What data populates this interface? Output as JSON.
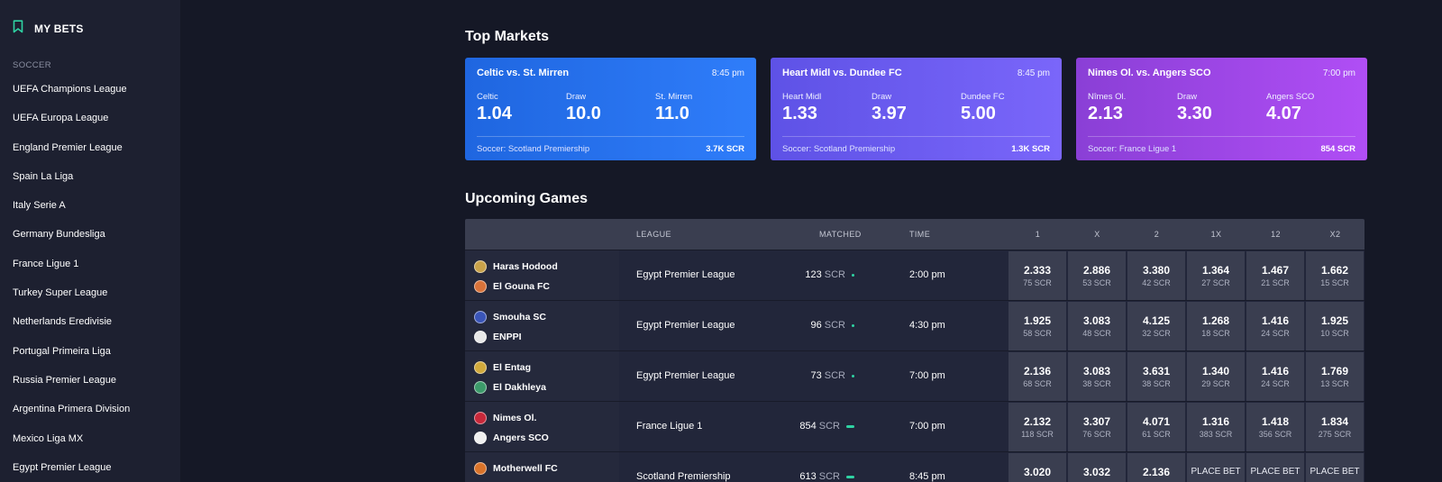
{
  "sidebar": {
    "my_bets_label": "MY BETS",
    "section_label": "SOCCER",
    "leagues": [
      "UEFA Champions League",
      "UEFA Europa League",
      "England Premier League",
      "Spain La Liga",
      "Italy Serie A",
      "Germany Bundesliga",
      "France Ligue 1",
      "Turkey Super League",
      "Netherlands Eredivisie",
      "Portugal Primeira Liga",
      "Russia Premier League",
      "Argentina Primera Division",
      "Mexico Liga MX",
      "Egypt Premier League"
    ]
  },
  "top_markets": {
    "heading": "Top Markets",
    "cards": [
      {
        "title": "Celtic vs. St. Mirren",
        "time": "8:45 pm",
        "odds": [
          {
            "label": "Celtic",
            "value": "1.04"
          },
          {
            "label": "Draw",
            "value": "10.0"
          },
          {
            "label": "St. Mirren",
            "value": "11.0"
          }
        ],
        "league": "Soccer: Scotland Premiership",
        "volume": "3.7K SCR",
        "gradient": [
          "#1f66e0",
          "#2f7dfa"
        ]
      },
      {
        "title": "Heart Midl vs. Dundee FC",
        "time": "8:45 pm",
        "odds": [
          {
            "label": "Heart Midl",
            "value": "1.33"
          },
          {
            "label": "Draw",
            "value": "3.97"
          },
          {
            "label": "Dundee FC",
            "value": "5.00"
          }
        ],
        "league": "Soccer: Scotland Premiership",
        "volume": "1.3K SCR",
        "gradient": [
          "#5e52e6",
          "#7a66fa"
        ]
      },
      {
        "title": "Nimes Ol. vs. Angers SCO",
        "time": "7:00 pm",
        "odds": [
          {
            "label": "Nîmes Ol.",
            "value": "2.13"
          },
          {
            "label": "Draw",
            "value": "3.30"
          },
          {
            "label": "Angers SCO",
            "value": "4.07"
          }
        ],
        "league": "Soccer: France Ligue 1",
        "volume": "854 SCR",
        "gradient": [
          "#8a3fd6",
          "#b04ef5"
        ]
      }
    ]
  },
  "upcoming": {
    "heading": "Upcoming Games",
    "columns": {
      "league": "LEAGUE",
      "matched": "MATCHED",
      "time": "TIME",
      "markets": [
        "1",
        "X",
        "2",
        "1X",
        "12",
        "X2"
      ]
    },
    "scr_unit": "SCR",
    "place_bet_label": "PLACE BET",
    "rows": [
      {
        "home": "Haras Hodood",
        "away": "El Gouna FC",
        "home_logo_color": "#c9a24a",
        "away_logo_color": "#d9733a",
        "league": "Egypt Premier League",
        "matched": "123",
        "indicator": "dot",
        "time": "2:00 pm",
        "odds": [
          {
            "v": "2.333",
            "s": "75 SCR"
          },
          {
            "v": "2.886",
            "s": "53 SCR"
          },
          {
            "v": "3.380",
            "s": "42 SCR"
          },
          {
            "v": "1.364",
            "s": "27 SCR"
          },
          {
            "v": "1.467",
            "s": "21 SCR"
          },
          {
            "v": "1.662",
            "s": "15 SCR"
          }
        ]
      },
      {
        "home": "Smouha SC",
        "away": "ENPPI",
        "home_logo_color": "#3a55b8",
        "away_logo_color": "#e8e8e8",
        "league": "Egypt Premier League",
        "matched": "96",
        "indicator": "dot",
        "time": "4:30 pm",
        "odds": [
          {
            "v": "1.925",
            "s": "58 SCR"
          },
          {
            "v": "3.083",
            "s": "48 SCR"
          },
          {
            "v": "4.125",
            "s": "32 SCR"
          },
          {
            "v": "1.268",
            "s": "18 SCR"
          },
          {
            "v": "1.416",
            "s": "24 SCR"
          },
          {
            "v": "1.925",
            "s": "10 SCR"
          }
        ]
      },
      {
        "home": "El Entag",
        "away": "El Dakhleya",
        "home_logo_color": "#d1a93c",
        "away_logo_color": "#3c9a6a",
        "league": "Egypt Premier League",
        "matched": "73",
        "indicator": "dot",
        "time": "7:00 pm",
        "odds": [
          {
            "v": "2.136",
            "s": "68 SCR"
          },
          {
            "v": "3.083",
            "s": "38 SCR"
          },
          {
            "v": "3.631",
            "s": "38 SCR"
          },
          {
            "v": "1.340",
            "s": "29 SCR"
          },
          {
            "v": "1.416",
            "s": "24 SCR"
          },
          {
            "v": "1.769",
            "s": "13 SCR"
          }
        ]
      },
      {
        "home": "Nimes Ol.",
        "away": "Angers SCO",
        "home_logo_color": "#c8283a",
        "away_logo_color": "#f0f0f0",
        "league": "France Ligue 1",
        "matched": "854",
        "indicator": "bar",
        "time": "7:00 pm",
        "odds": [
          {
            "v": "2.132",
            "s": "118 SCR"
          },
          {
            "v": "3.307",
            "s": "76 SCR"
          },
          {
            "v": "4.071",
            "s": "61 SCR"
          },
          {
            "v": "1.316",
            "s": "383 SCR"
          },
          {
            "v": "1.418",
            "s": "356 SCR"
          },
          {
            "v": "1.834",
            "s": "275 SCR"
          }
        ]
      },
      {
        "home": "Motherwell FC",
        "away": "",
        "home_logo_color": "#d9732a",
        "away_logo_color": "#2a9a5a",
        "league": "Scotland Premiership",
        "matched": "613",
        "indicator": "bar",
        "time": "8:45 pm",
        "odds": [
          {
            "v": "3.020",
            "s": ""
          },
          {
            "v": "3.032",
            "s": ""
          },
          {
            "v": "2.136",
            "s": ""
          },
          {
            "place": true
          },
          {
            "place": true
          },
          {
            "place": true
          }
        ]
      }
    ]
  },
  "colors": {
    "background": "#151826",
    "sidebar": "#1d2030",
    "accent": "#2fd3a3"
  }
}
